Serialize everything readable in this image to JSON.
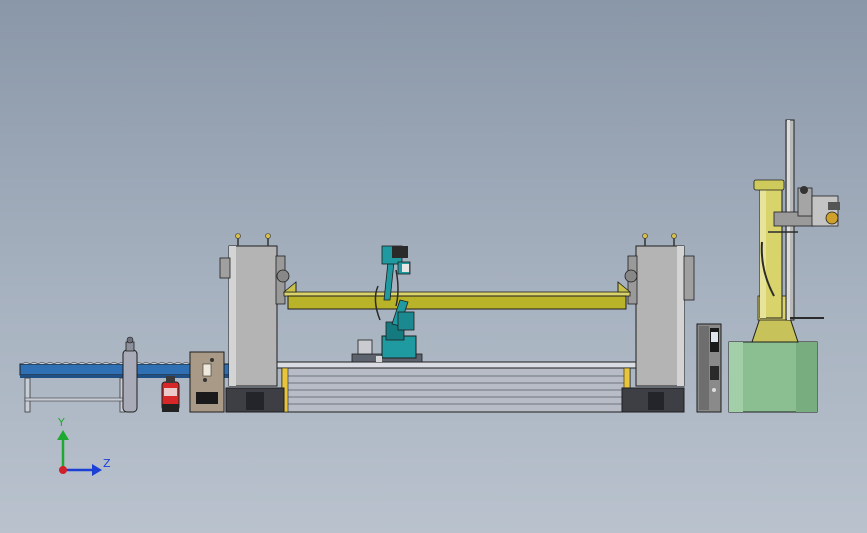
{
  "viewport": {
    "colors": {
      "background_top": "#8a97a8",
      "background_bottom": "#b9c2cd",
      "outline": "#1e1e1e"
    }
  },
  "model": {
    "components": [
      {
        "name": "roller-conveyor",
        "color": "#2f6fb3"
      },
      {
        "name": "gas-cylinder",
        "color": "#a9acb8"
      },
      {
        "name": "fire-extinguisher",
        "color": "#d62828"
      },
      {
        "name": "welding-power-source",
        "color": "#a89a86"
      },
      {
        "name": "headstock-positioner",
        "color": "#b4b4b4"
      },
      {
        "name": "tailstock-positioner",
        "color": "#b4b4b4"
      },
      {
        "name": "workpiece-beam",
        "color": "#b9b32a"
      },
      {
        "name": "robot-track-base",
        "color": "#b8bcc6"
      },
      {
        "name": "welding-robot",
        "color": "#1e9aa0"
      },
      {
        "name": "robot-controller-cabinet",
        "color": "#8a8a8a"
      },
      {
        "name": "column-boom-manipulator",
        "color": "#d8d36a"
      },
      {
        "name": "manipulator-base",
        "color": "#8bbf92"
      }
    ]
  },
  "triad": {
    "y_label": "Y",
    "z_label": "Z",
    "colors": {
      "y": "#1fa832",
      "z": "#1c3fd6",
      "x": "#d0202a"
    }
  }
}
